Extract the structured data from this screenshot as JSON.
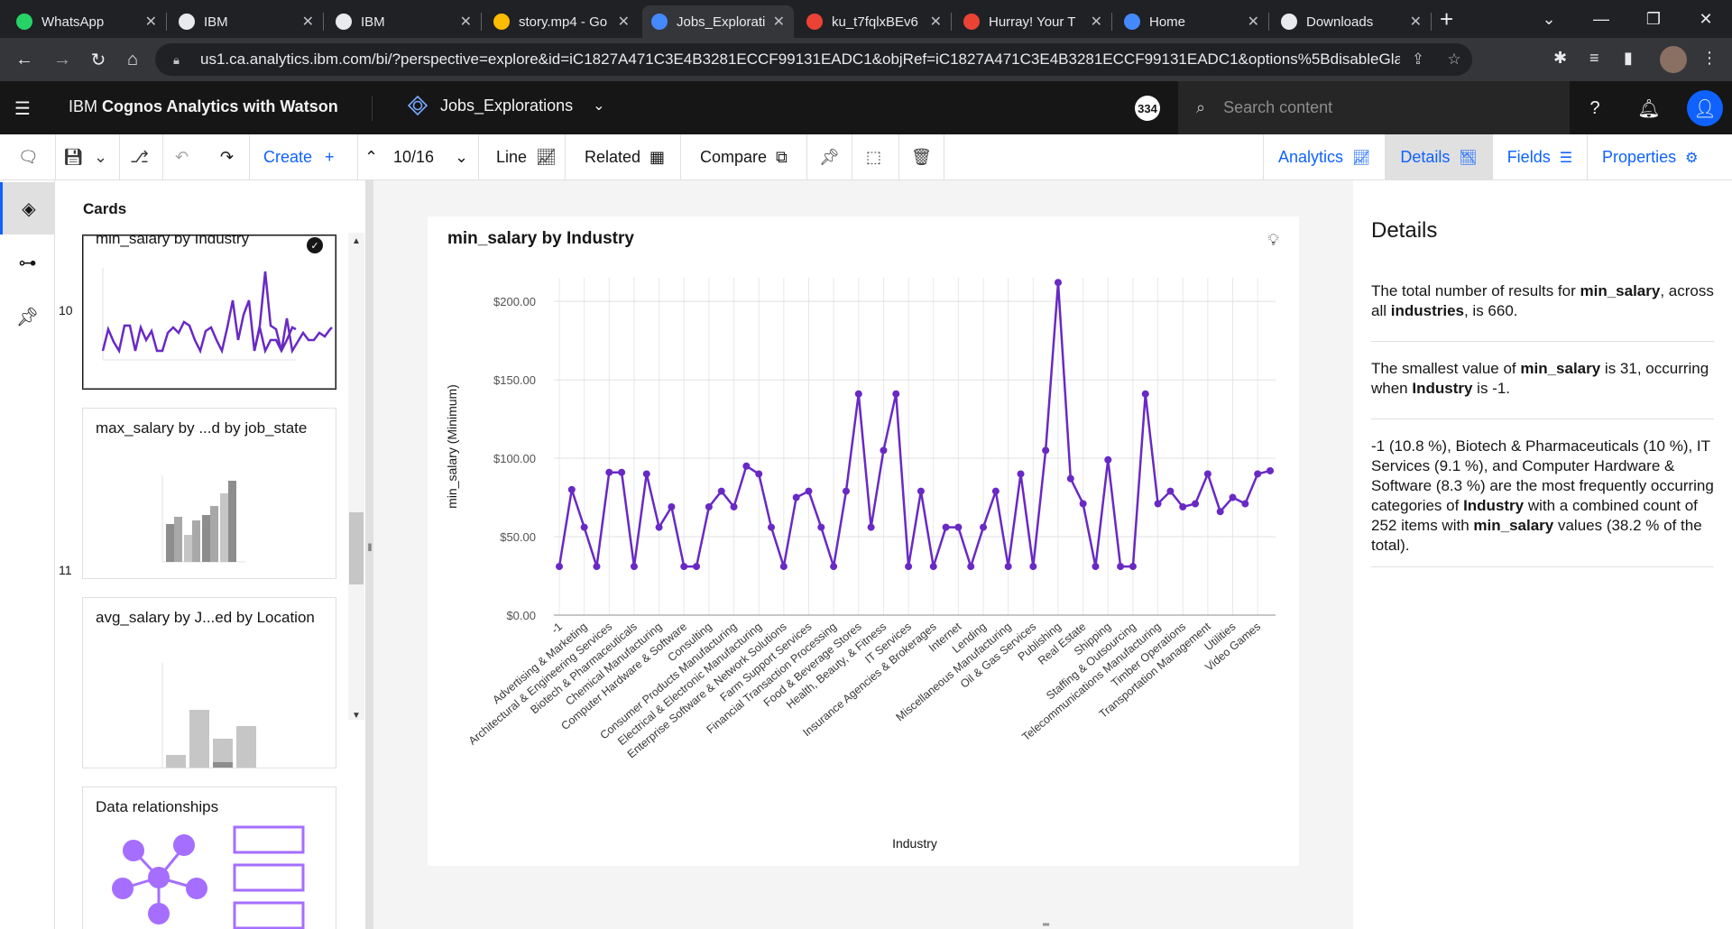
{
  "browser": {
    "tabs": [
      {
        "title": "WhatsApp",
        "icon": "whatsapp-icon",
        "color": "#25d366"
      },
      {
        "title": "IBM",
        "icon": "globe-icon",
        "color": "#e8eaed"
      },
      {
        "title": "IBM",
        "icon": "globe-icon",
        "color": "#e8eaed"
      },
      {
        "title": "story.mp4 - Go",
        "icon": "google-drive-icon",
        "color": "#fbbc04"
      },
      {
        "title": "Jobs_Explorati",
        "icon": "cognos-icon",
        "color": "#4589ff"
      },
      {
        "title": "ku_t7fqlxBEv6",
        "icon": "google-photos-icon",
        "color": "#ea4335"
      },
      {
        "title": "Hurray! Your T",
        "icon": "gmail-icon",
        "color": "#ea4335"
      },
      {
        "title": "Home",
        "icon": "cognos-icon",
        "color": "#4589ff"
      },
      {
        "title": "Downloads",
        "icon": "download-icon",
        "color": "#e8eaed"
      }
    ],
    "url": "us1.ca.analytics.ibm.com/bi/?perspective=explore&id=iC1827A471C3E4B3281ECCF99131EADC1&objRef=iC1827A471C3E4B3281ECCF99131EADC1&options%5BdisableGlassPrefet..."
  },
  "app": {
    "brand_light": "IBM ",
    "brand_bold": "Cognos Analytics with Watson",
    "workspace": "Jobs_Explorations",
    "badge": "334",
    "search_placeholder": "Search content"
  },
  "toolbar": {
    "create": "Create",
    "page": "10/16",
    "line": "Line",
    "related": "Related",
    "compare": "Compare",
    "right_tabs": [
      "Analytics",
      "Details",
      "Fields",
      "Properties"
    ]
  },
  "cards": {
    "title": "Cards",
    "items": [
      {
        "num": "10",
        "title": "min_salary by Industry"
      },
      {
        "num": "11",
        "title": "max_salary by ...d by job_state"
      },
      {
        "num": "",
        "title": "avg_salary by J...ed by Location"
      },
      {
        "num": "",
        "title": "Data relationships"
      }
    ]
  },
  "chart_data": {
    "type": "line",
    "title": "min_salary by Industry",
    "xlabel": "Industry",
    "ylabel": "min_salary (Minimum)",
    "ylim": [
      0,
      215
    ],
    "yticks": [
      "$0.00",
      "$50.00",
      "$100.00",
      "$150.00",
      "$200.00"
    ],
    "ytick_values": [
      0,
      50,
      100,
      150,
      200
    ],
    "color": "#6929c4",
    "labels": [
      "-1",
      "Advertising & Marketing",
      "Architectural & Engineering Services",
      "Biotech & Pharmaceuticals",
      "Chemical Manufacturing",
      "Computer Hardware & Software",
      "Consulting",
      "Consumer Products Manufacturing",
      "Electrical & Electronic Manufacturing",
      "Enterprise Software & Network Solutions",
      "Farm Support Services",
      "Financial Transaction Processing",
      "Food & Beverage Stores",
      "Health, Beauty, & Fitness",
      "IT Services",
      "Insurance Agencies & Brokerages",
      "Internet",
      "Lending",
      "Miscellaneous Manufacturing",
      "Oil & Gas Services",
      "Publishing",
      "Real Estate",
      "Shipping",
      "Staffing & Outsourcing",
      "Telecommunications Manufacturing",
      "Timber Operations",
      "Transportation Management",
      "Utilities",
      "Video Games"
    ],
    "values": [
      31,
      80,
      56,
      31,
      91,
      91,
      31,
      90,
      56,
      69,
      31,
      31,
      69,
      79,
      69,
      95,
      90,
      56,
      31,
      75,
      79,
      56,
      31,
      79,
      141,
      56,
      105,
      141,
      31,
      79,
      31,
      56,
      56,
      31,
      56,
      79,
      31,
      90,
      31,
      105,
      212,
      87,
      71,
      31,
      99,
      31,
      31,
      141,
      71,
      79,
      69,
      71,
      90,
      66,
      75,
      71,
      90,
      92
    ],
    "label_every": 2
  },
  "details": {
    "title": "Details",
    "p1": [
      "The total number of results for ",
      "min_salary",
      ", across all ",
      "industries",
      ", is 660."
    ],
    "p2": [
      "The smallest value of ",
      "min_salary",
      " is 31, occurring when ",
      "Industry",
      " is -1."
    ],
    "p3": [
      "-1 (10.8 %), Biotech & Pharmaceuticals (10 %), IT Services (9.1 %), and Computer Hardware & Software (8.3 %) are the most frequently occurring categories of ",
      "Industry",
      " with a combined count of 252 items with ",
      "min_salary",
      " values (38.2 % of the total)."
    ]
  }
}
